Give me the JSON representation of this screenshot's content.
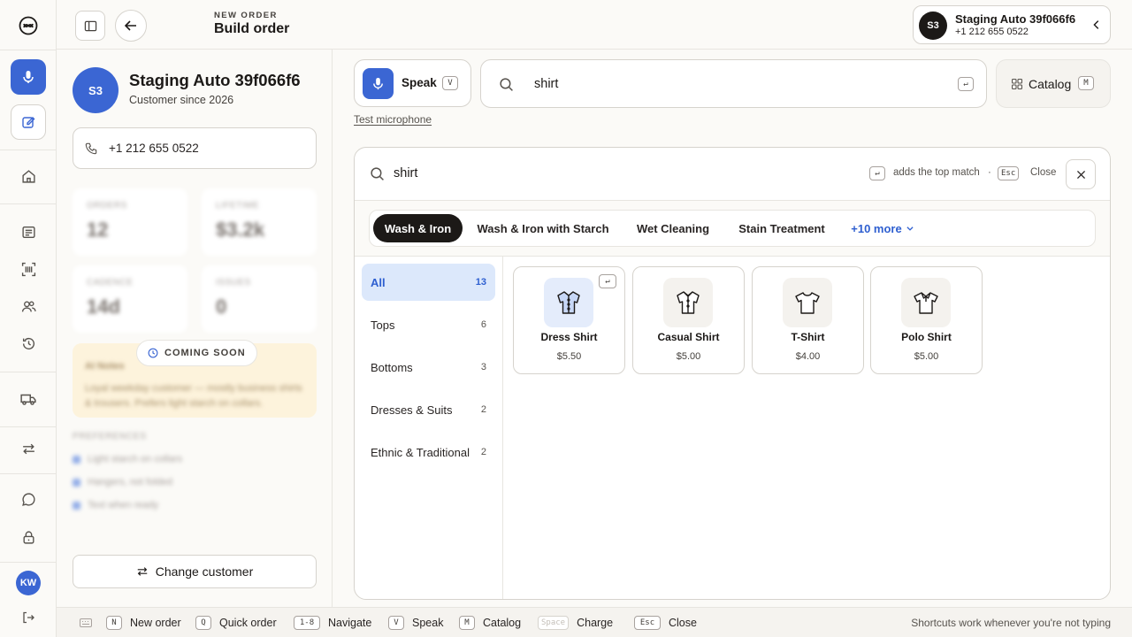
{
  "header": {
    "eyebrow": "NEW ORDER",
    "title": "Build order"
  },
  "customer_pill": {
    "initials": "S3",
    "name": "Staging Auto 39f066f6",
    "phone": "+1 212 655 0522"
  },
  "rail": {
    "user_initials": "KW"
  },
  "customer": {
    "initials": "S3",
    "name": "Staging Auto 39f066f6",
    "since": "Customer since 2026",
    "phone": "+1 212 655 0522",
    "stats": [
      {
        "label": "ORDERS",
        "value": "12"
      },
      {
        "label": "LIFETIME",
        "value": "$3.2k"
      },
      {
        "label": "CADENCE",
        "value": "14d"
      },
      {
        "label": "ISSUES",
        "value": "0"
      }
    ],
    "coming_soon": "COMING SOON",
    "ai_note_title": "AI Notes",
    "ai_note_text": "Loyal weekday customer — mostly business shirts & trousers. Prefers light starch on collars.",
    "prefs_label": "PREFERENCES",
    "prefs": [
      "Light starch on collars",
      "Hangers, not folded",
      "Text when ready"
    ],
    "change_label": "Change customer"
  },
  "toolbar": {
    "speak_label": "Speak",
    "speak_key": "V",
    "search_value": "shirt",
    "enter_key": "↵",
    "catalog_label": "Catalog",
    "catalog_key": "M",
    "test_mic": "Test microphone"
  },
  "results": {
    "query": "shirt",
    "enter_key": "↵",
    "hint": "adds the top match",
    "dot": "·",
    "esc_key": "Esc",
    "close_label": "Close",
    "services": [
      {
        "label": "Wash & Iron",
        "active": true
      },
      {
        "label": "Wash & Iron with Starch"
      },
      {
        "label": "Wet Cleaning"
      },
      {
        "label": "Stain Treatment"
      }
    ],
    "more_label": "+10 more",
    "categories": [
      {
        "label": "All",
        "count": "13"
      },
      {
        "label": "Tops",
        "count": "6"
      },
      {
        "label": "Bottoms",
        "count": "3"
      },
      {
        "label": "Dresses & Suits",
        "count": "2"
      },
      {
        "label": "Ethnic & Traditional",
        "count": "2"
      }
    ],
    "items": [
      {
        "name": "Dress Shirt",
        "price": "$5.50",
        "icon": "dress-shirt-icon"
      },
      {
        "name": "Casual Shirt",
        "price": "$5.00",
        "icon": "casual-shirt-icon"
      },
      {
        "name": "T-Shirt",
        "price": "$4.00",
        "icon": "tshirt-icon"
      },
      {
        "name": "Polo Shirt",
        "price": "$5.00",
        "icon": "polo-shirt-icon"
      }
    ]
  },
  "shortcuts": [
    {
      "key": "N",
      "label": "New order"
    },
    {
      "key": "Q",
      "label": "Quick order"
    },
    {
      "key": "1-8",
      "label": "Navigate"
    },
    {
      "key": "V",
      "label": "Speak"
    },
    {
      "key": "M",
      "label": "Catalog"
    },
    {
      "key": "Space",
      "label": "Charge"
    },
    {
      "key": "Esc",
      "label": "Close"
    }
  ],
  "shortcuts_note": "Shortcuts work whenever you're not typing",
  "colors": {
    "accent": "#3b66d3",
    "dark": "#1c1917",
    "selected_bg": "#dce8fb"
  }
}
